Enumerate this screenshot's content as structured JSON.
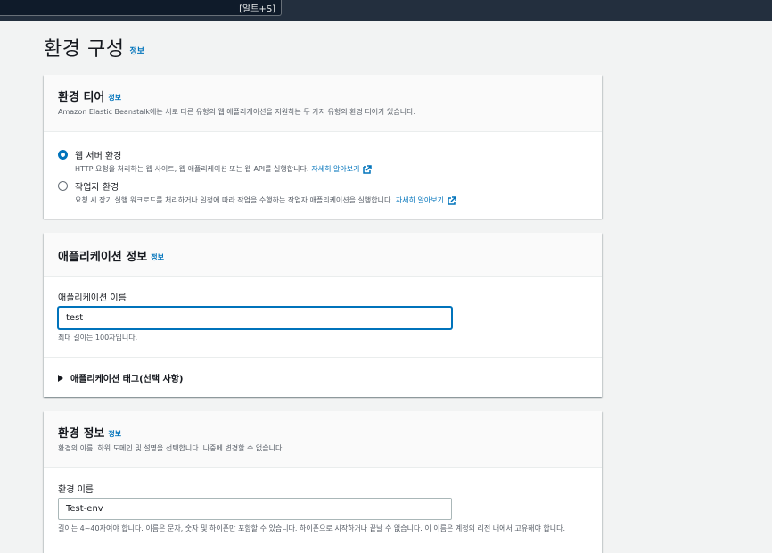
{
  "topbar": {
    "shortcut": "[알트+S]"
  },
  "page": {
    "title": "환경 구성",
    "info": "정보"
  },
  "tier": {
    "title": "환경 티어",
    "info": "정보",
    "desc": "Amazon Elastic Beanstalk에는 서로 다른 유형의 웹 애플리케이션을 지원하는 두 가지 유형의 환경 티어가 있습니다.",
    "options": [
      {
        "label": "웹 서버 환경",
        "desc": "HTTP 요청을 처리하는 웹 사이트, 웹 애플리케이션 또는 웹 API를 실행합니다.",
        "link": "자세히 알아보기",
        "selected": true
      },
      {
        "label": "작업자 환경",
        "desc": "요청 시 장기 실행 워크로드를 처리하거나 일정에 따라 작업을 수행하는 작업자 애플리케이션을 실행합니다.",
        "link": "자세히 알아보기",
        "selected": false
      }
    ]
  },
  "app": {
    "title": "애플리케이션 정보",
    "info": "정보",
    "name_label": "애플리케이션 이름",
    "name_value": "test",
    "name_hint": "최대 길이는 100자입니다.",
    "tags_label": "애플리케이션 태그(선택 사항)"
  },
  "env": {
    "title": "환경 정보",
    "info": "정보",
    "desc": "환경의 이름, 하위 도메인 및 설명을 선택합니다. 나중에 변경할 수 없습니다.",
    "name_label": "환경 이름",
    "name_value": "Test-env",
    "name_hint": "길이는 4~40자여야 합니다. 이름은 문자, 숫자 및 하이픈만 포함할 수 있습니다. 하이픈으로 시작하거나 끝날 수 없습니다. 이 이름은 계정의 리전 내에서 고유해야 합니다."
  },
  "colors": {
    "accent": "#0073bb",
    "topbar": "#232f3e",
    "background": "#f2f3f3"
  }
}
